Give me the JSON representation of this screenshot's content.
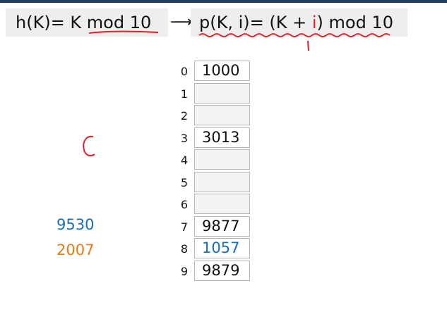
{
  "hash_formula": {
    "text": "h(K)= K mod 10"
  },
  "probe_formula": {
    "prefix": "p(K, i)= (K + ",
    "i": "i",
    "suffix": ") mod 10"
  },
  "table": {
    "rows": [
      {
        "index": "0",
        "value": "1000",
        "color": "#111111"
      },
      {
        "index": "1",
        "value": "",
        "color": "#111111"
      },
      {
        "index": "2",
        "value": "",
        "color": "#111111"
      },
      {
        "index": "3",
        "value": "3013",
        "color": "#111111"
      },
      {
        "index": "4",
        "value": "",
        "color": "#111111"
      },
      {
        "index": "5",
        "value": "",
        "color": "#111111"
      },
      {
        "index": "6",
        "value": "",
        "color": "#111111"
      },
      {
        "index": "7",
        "value": "9877",
        "color": "#111111"
      },
      {
        "index": "8",
        "value": "1057",
        "color": "#1a6fb5"
      },
      {
        "index": "9",
        "value": "9879",
        "color": "#111111"
      }
    ]
  },
  "pending_keys": [
    {
      "value": "9530",
      "color": "#1a6fb5"
    },
    {
      "value": "2007",
      "color": "#e07b17"
    }
  ],
  "colors": {
    "annotation": "#e3202a",
    "top_bar": "#1f3a66"
  }
}
